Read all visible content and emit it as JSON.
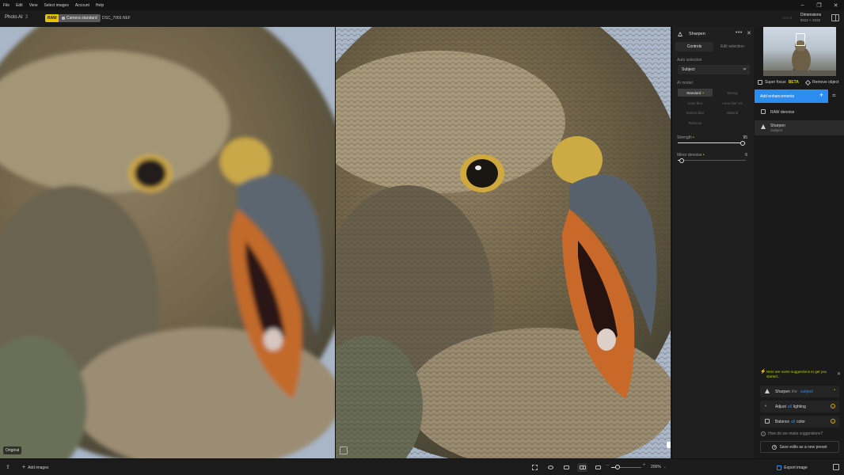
{
  "menubar": {
    "items": [
      "File",
      "Edit",
      "View",
      "Select images",
      "Account",
      "Help"
    ],
    "window_controls": [
      "minimize-icon",
      "restore-icon",
      "close-icon"
    ]
  },
  "header": {
    "app_name": "Photo AI",
    "app_version": "3",
    "raw_badge": "RAW",
    "camera_profile": "Camera standard",
    "filename": "DSC_7069.NEF",
    "version_hint": "v3.0.0",
    "dimensions_label": "Dimensions",
    "dimensions_value": "8032 × 4032"
  },
  "viewer": {
    "original_label": "Original"
  },
  "settings": {
    "title": "Sharpen",
    "tabs": [
      "Controls",
      "Edit selection"
    ],
    "auto_selection_label": "Auto selection",
    "auto_selection_value": "Subject",
    "ai_model_label": "AI model",
    "models": [
      "Standard",
      "Strong",
      "Lens blur",
      "Lens blur V2",
      "Motion blur",
      "Natural",
      "Refocus"
    ],
    "strength_label": "Strength",
    "strength_value": "95",
    "strength_level": 0.95,
    "minor_denoise_label": "Minor denoise",
    "minor_denoise_value": "6",
    "minor_denoise_level": 0.06
  },
  "panel": {
    "super_focus": "Super focus",
    "beta": "BETA",
    "remove_object": "Remove object",
    "add_enhancements": "Add enhancements",
    "enhancements": [
      {
        "name": "RAW denoise",
        "sub": ""
      },
      {
        "name": "Sharpen",
        "sub": "Subject"
      }
    ],
    "suggestions_header": "Here are some suggestions to get you started...",
    "suggestions": [
      {
        "verb": "Sharpen",
        "prep": "the",
        "target": "subject"
      },
      {
        "verb": "Adjust",
        "prep": "all",
        "target": "lighting"
      },
      {
        "verb": "Balance",
        "prep": "all",
        "target": "color"
      }
    ],
    "how_do": "How do we make suggestions?",
    "save_preset": "Save edits as a new preset"
  },
  "bottombar": {
    "add_images": "Add images",
    "zoom": "200%",
    "zoom_level": 0.2,
    "export": "Export image"
  },
  "colors": {
    "accent": "#2d8cf0",
    "badge_yellow": "#e6c200",
    "suggestion_green": "#b8d400"
  }
}
